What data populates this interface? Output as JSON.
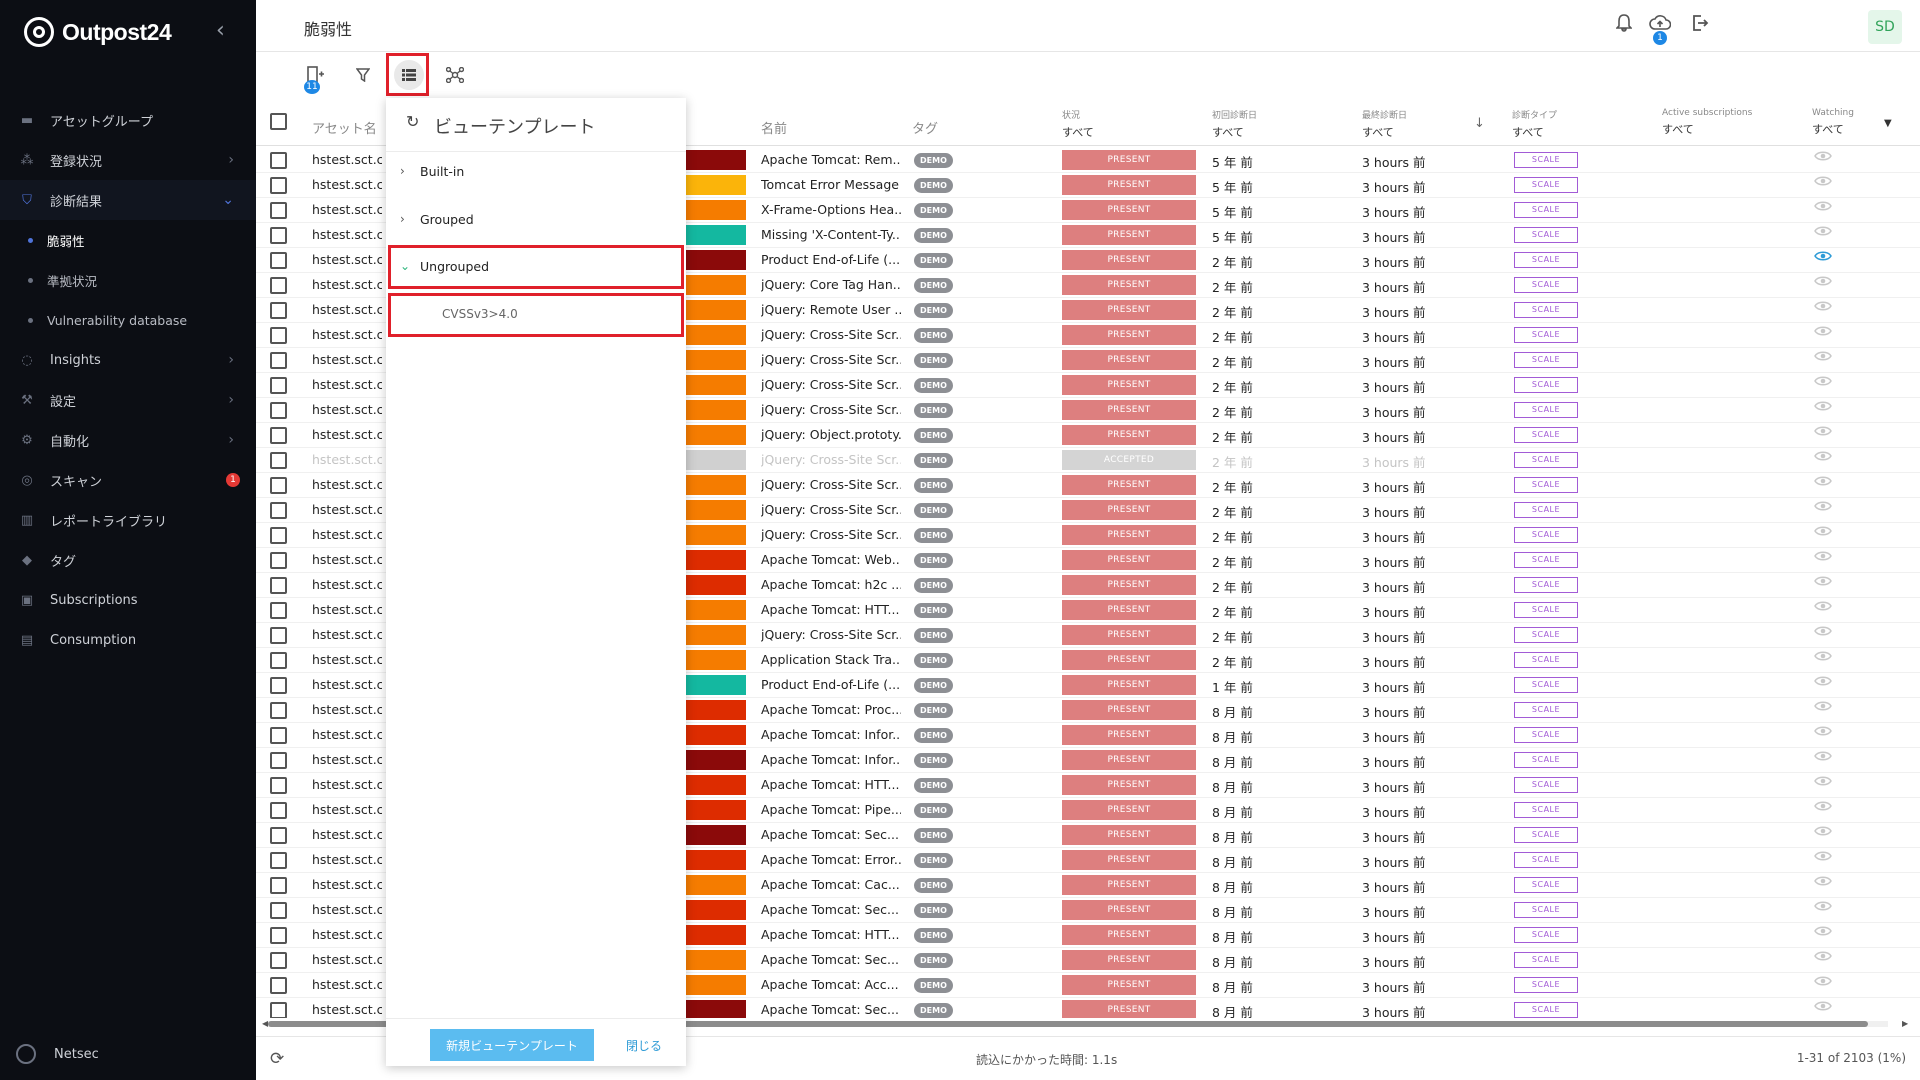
{
  "app": {
    "brand": "Outpost24",
    "user_initials": "SD",
    "org": "Netsec"
  },
  "sidebar": {
    "items": [
      {
        "label": "アセットグループ",
        "icon": "folder-icon",
        "chevron": false
      },
      {
        "label": "登録状況",
        "icon": "network-icon",
        "chevron": true
      },
      {
        "label": "診断結果",
        "icon": "shield-icon",
        "chevron": true,
        "active": true
      },
      {
        "label": "脆弱性",
        "sub": true,
        "active": true
      },
      {
        "label": "準拠状況",
        "sub": true
      },
      {
        "label": "Vulnerability database",
        "sub": true
      },
      {
        "label": "Insights",
        "icon": "lightbulb-icon",
        "chevron": true
      },
      {
        "label": "設定",
        "icon": "wrench-icon",
        "chevron": true
      },
      {
        "label": "自動化",
        "icon": "automation-icon",
        "chevron": true
      },
      {
        "label": "スキャン",
        "icon": "radar-icon",
        "badge": "1"
      },
      {
        "label": "レポートライブラリ",
        "icon": "library-icon"
      },
      {
        "label": "タグ",
        "icon": "tag-icon"
      },
      {
        "label": "Subscriptions",
        "icon": "subscriptions-icon"
      },
      {
        "label": "Consumption",
        "icon": "consumption-icon"
      }
    ]
  },
  "header": {
    "title": "脆弱性",
    "cloud_badge": "1"
  },
  "toolbar": {
    "assets_badge": "11"
  },
  "table": {
    "headers": {
      "asset": "アセット名",
      "name": "名前",
      "tag": "タグ",
      "status": {
        "label": "状況",
        "filter": "すべて"
      },
      "first_seen": {
        "label": "初回診断日",
        "filter": "すべて"
      },
      "last_seen": {
        "label": "最終診断日",
        "filter": "すべて"
      },
      "scan_type": {
        "label": "診断タイプ",
        "filter": "すべて"
      },
      "subs": {
        "label": "Active subscriptions",
        "filter": "すべて"
      },
      "watching": {
        "label": "Watching",
        "filter": "すべて"
      }
    },
    "rows": [
      {
        "asset": "hstest.sct.co",
        "sev": "#8b0a0a",
        "name": "Apache Tomcat: Rem...",
        "tag": "DEMO",
        "status": "PRESENT",
        "first": "5 年 前",
        "last": "3 hours 前",
        "type": "SCALE",
        "watch": false
      },
      {
        "asset": "hstest.sct.co",
        "sev": "#fbb40a",
        "name": "Tomcat Error Message",
        "tag": "DEMO",
        "status": "PRESENT",
        "first": "5 年 前",
        "last": "3 hours 前",
        "type": "SCALE",
        "watch": false
      },
      {
        "asset": "hstest.sct.co",
        "sev": "#f57c00",
        "name": "X-Frame-Options Hea...",
        "tag": "DEMO",
        "status": "PRESENT",
        "first": "5 年 前",
        "last": "3 hours 前",
        "type": "SCALE",
        "watch": false
      },
      {
        "asset": "hstest.sct.co",
        "sev": "#14b8a0",
        "name": "Missing 'X-Content-Ty...",
        "tag": "DEMO",
        "status": "PRESENT",
        "first": "5 年 前",
        "last": "3 hours 前",
        "type": "SCALE",
        "watch": false
      },
      {
        "asset": "hstest.sct.co",
        "sev": "#8b0a0a",
        "name": "Product End-of-Life (...",
        "tag": "DEMO",
        "status": "PRESENT",
        "first": "2 年 前",
        "last": "3 hours 前",
        "type": "SCALE",
        "watch": true
      },
      {
        "asset": "hstest.sct.co",
        "sev": "#f57c00",
        "name": "jQuery: Core Tag Han...",
        "tag": "DEMO",
        "status": "PRESENT",
        "first": "2 年 前",
        "last": "3 hours 前",
        "type": "SCALE",
        "watch": false
      },
      {
        "asset": "hstest.sct.co",
        "sev": "#f57c00",
        "name": "jQuery: Remote User ...",
        "tag": "DEMO",
        "status": "PRESENT",
        "first": "2 年 前",
        "last": "3 hours 前",
        "type": "SCALE",
        "watch": false
      },
      {
        "asset": "hstest.sct.co",
        "sev": "#f57c00",
        "name": "jQuery: Cross-Site Scr...",
        "tag": "DEMO",
        "status": "PRESENT",
        "first": "2 年 前",
        "last": "3 hours 前",
        "type": "SCALE",
        "watch": false
      },
      {
        "asset": "hstest.sct.co",
        "sev": "#f57c00",
        "name": "jQuery: Cross-Site Scr...",
        "tag": "DEMO",
        "status": "PRESENT",
        "first": "2 年 前",
        "last": "3 hours 前",
        "type": "SCALE",
        "watch": false
      },
      {
        "asset": "hstest.sct.co",
        "sev": "#f57c00",
        "name": "jQuery: Cross-Site Scr...",
        "tag": "DEMO",
        "status": "PRESENT",
        "first": "2 年 前",
        "last": "3 hours 前",
        "type": "SCALE",
        "watch": false
      },
      {
        "asset": "hstest.sct.co",
        "sev": "#f57c00",
        "name": "jQuery: Cross-Site Scr...",
        "tag": "DEMO",
        "status": "PRESENT",
        "first": "2 年 前",
        "last": "3 hours 前",
        "type": "SCALE",
        "watch": false
      },
      {
        "asset": "hstest.sct.co",
        "sev": "#f57c00",
        "name": "jQuery: Object.prototy...",
        "tag": "DEMO",
        "status": "PRESENT",
        "first": "2 年 前",
        "last": "3 hours 前",
        "type": "SCALE",
        "watch": false
      },
      {
        "asset": "hstest.sct.co",
        "sev": "#d0d0d0",
        "name": "jQuery: Cross-Site Scr...",
        "tag": "DEMO",
        "status": "ACCEPTED",
        "first": "2 年 前",
        "last": "3 hours 前",
        "type": "SCALE",
        "watch": false,
        "dim": true
      },
      {
        "asset": "hstest.sct.co",
        "sev": "#f57c00",
        "name": "jQuery: Cross-Site Scr...",
        "tag": "DEMO",
        "status": "PRESENT",
        "first": "2 年 前",
        "last": "3 hours 前",
        "type": "SCALE",
        "watch": false
      },
      {
        "asset": "hstest.sct.co",
        "sev": "#f57c00",
        "name": "jQuery: Cross-Site Scr...",
        "tag": "DEMO",
        "status": "PRESENT",
        "first": "2 年 前",
        "last": "3 hours 前",
        "type": "SCALE",
        "watch": false
      },
      {
        "asset": "hstest.sct.co",
        "sev": "#f57c00",
        "name": "jQuery: Cross-Site Scr...",
        "tag": "DEMO",
        "status": "PRESENT",
        "first": "2 年 前",
        "last": "3 hours 前",
        "type": "SCALE",
        "watch": false
      },
      {
        "asset": "hstest.sct.co",
        "sev": "#dd2c00",
        "name": "Apache Tomcat: Web...",
        "tag": "DEMO",
        "status": "PRESENT",
        "first": "2 年 前",
        "last": "3 hours 前",
        "type": "SCALE",
        "watch": false
      },
      {
        "asset": "hstest.sct.co",
        "sev": "#dd2c00",
        "name": "Apache Tomcat: h2c ...",
        "tag": "DEMO",
        "status": "PRESENT",
        "first": "2 年 前",
        "last": "3 hours 前",
        "type": "SCALE",
        "watch": false
      },
      {
        "asset": "hstest.sct.co",
        "sev": "#f57c00",
        "name": "Apache Tomcat: HTT...",
        "tag": "DEMO",
        "status": "PRESENT",
        "first": "2 年 前",
        "last": "3 hours 前",
        "type": "SCALE",
        "watch": false
      },
      {
        "asset": "hstest.sct.co",
        "sev": "#f57c00",
        "name": "jQuery: Cross-Site Scr...",
        "tag": "DEMO",
        "status": "PRESENT",
        "first": "2 年 前",
        "last": "3 hours 前",
        "type": "SCALE",
        "watch": false
      },
      {
        "asset": "hstest.sct.co",
        "sev": "#f57c00",
        "name": "Application Stack Tra...",
        "tag": "DEMO",
        "status": "PRESENT",
        "first": "2 年 前",
        "last": "3 hours 前",
        "type": "SCALE",
        "watch": false
      },
      {
        "asset": "hstest.sct.co",
        "sev": "#14b8a0",
        "name": "Product End-of-Life (...",
        "tag": "DEMO",
        "status": "PRESENT",
        "first": "1 年 前",
        "last": "3 hours 前",
        "type": "SCALE",
        "watch": false
      },
      {
        "asset": "hstest.sct.co",
        "sev": "#dd2c00",
        "name": "Apache Tomcat: Proc...",
        "tag": "DEMO",
        "status": "PRESENT",
        "first": "8 月 前",
        "last": "3 hours 前",
        "type": "SCALE",
        "watch": false
      },
      {
        "asset": "hstest.sct.co",
        "sev": "#dd2c00",
        "name": "Apache Tomcat: Infor...",
        "tag": "DEMO",
        "status": "PRESENT",
        "first": "8 月 前",
        "last": "3 hours 前",
        "type": "SCALE",
        "watch": false
      },
      {
        "asset": "hstest.sct.co",
        "sev": "#8b0a0a",
        "name": "Apache Tomcat: Infor...",
        "tag": "DEMO",
        "status": "PRESENT",
        "first": "8 月 前",
        "last": "3 hours 前",
        "type": "SCALE",
        "watch": false
      },
      {
        "asset": "hstest.sct.co",
        "sev": "#dd2c00",
        "name": "Apache Tomcat: HTT...",
        "tag": "DEMO",
        "status": "PRESENT",
        "first": "8 月 前",
        "last": "3 hours 前",
        "type": "SCALE",
        "watch": false
      },
      {
        "asset": "hstest.sct.co",
        "sev": "#dd2c00",
        "name": "Apache Tomcat: Pipe...",
        "tag": "DEMO",
        "status": "PRESENT",
        "first": "8 月 前",
        "last": "3 hours 前",
        "type": "SCALE",
        "watch": false
      },
      {
        "asset": "hstest.sct.co",
        "sev": "#8b0a0a",
        "name": "Apache Tomcat: Sec...",
        "tag": "DEMO",
        "status": "PRESENT",
        "first": "8 月 前",
        "last": "3 hours 前",
        "type": "SCALE",
        "watch": false
      },
      {
        "asset": "hstest.sct.co",
        "sev": "#dd2c00",
        "name": "Apache Tomcat: Error...",
        "tag": "DEMO",
        "status": "PRESENT",
        "first": "8 月 前",
        "last": "3 hours 前",
        "type": "SCALE",
        "watch": false
      },
      {
        "asset": "hstest.sct.co",
        "sev": "#f57c00",
        "name": "Apache Tomcat: Cac...",
        "tag": "DEMO",
        "status": "PRESENT",
        "first": "8 月 前",
        "last": "3 hours 前",
        "type": "SCALE",
        "watch": false
      },
      {
        "asset": "hstest.sct.co",
        "sev": "#dd2c00",
        "name": "Apache Tomcat: Sec...",
        "tag": "DEMO",
        "status": "PRESENT",
        "first": "8 月 前",
        "last": "3 hours 前",
        "type": "SCALE",
        "watch": false
      },
      {
        "asset": "hstest.sct.co",
        "sev": "#dd2c00",
        "name": "Apache Tomcat: HTT...",
        "tag": "DEMO",
        "status": "PRESENT",
        "first": "8 月 前",
        "last": "3 hours 前",
        "type": "SCALE",
        "watch": false
      },
      {
        "asset": "hstest.sct.co",
        "sev": "#f57c00",
        "name": "Apache Tomcat: Sec...",
        "tag": "DEMO",
        "status": "PRESENT",
        "first": "8 月 前",
        "last": "3 hours 前",
        "type": "SCALE",
        "watch": false
      },
      {
        "asset": "hstest.sct.co",
        "sev": "#f57c00",
        "name": "Apache Tomcat: Acc...",
        "tag": "DEMO",
        "status": "PRESENT",
        "first": "8 月 前",
        "last": "3 hours 前",
        "type": "SCALE",
        "watch": false
      },
      {
        "asset": "hstest.sct.co",
        "sev": "#8b0a0a",
        "name": "Apache Tomcat: Sec...",
        "tag": "DEMO",
        "status": "PRESENT",
        "first": "8 月 前",
        "last": "3 hours 前",
        "type": "SCALE",
        "watch": false
      }
    ]
  },
  "footer": {
    "load_time": "読込にかかった時間: 1.1s",
    "count": "1-31 of 2103 (1%)"
  },
  "popup": {
    "title": "ビューテンプレート",
    "groups": [
      {
        "label": "Built-in",
        "open": false
      },
      {
        "label": "Grouped",
        "open": false
      },
      {
        "label": "Ungrouped",
        "open": true
      }
    ],
    "template_item": "CVSSv3>4.0",
    "new_button": "新規ビューテンプレート",
    "close_button": "閉じる"
  }
}
